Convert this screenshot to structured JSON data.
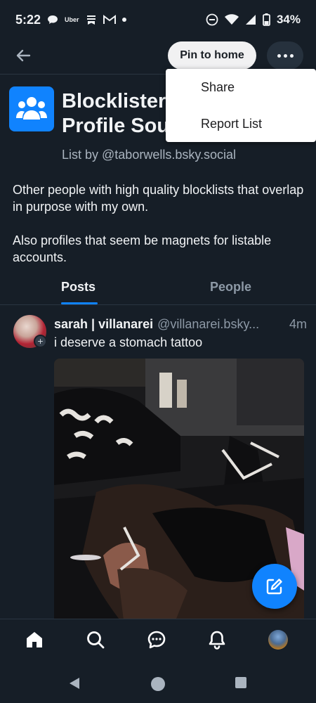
{
  "statusbar": {
    "time": "5:22",
    "uber": "Uber",
    "battery": "34%"
  },
  "topbar": {
    "pin_label": "Pin to home"
  },
  "menu": {
    "items": [
      "Share",
      "Report List"
    ]
  },
  "list": {
    "title_line1": "Blocklister",
    "title_line2": "Profile Sou",
    "by": "List by @taborwells.bsky.social",
    "desc1": "Other people with high quality blocklists that overlap in purpose with my own.",
    "desc2": "Also profiles that seem be magnets for listable accounts."
  },
  "tabs": [
    "Posts",
    "People"
  ],
  "post": {
    "name": "sarah | villanarei",
    "handle": "@villanarei.bsky...",
    "time": "4m",
    "text": "i deserve a stomach tattoo",
    "follow_symbol": "+"
  },
  "colors": {
    "background": "#161e27",
    "accent": "#1083fe",
    "menu_bg": "#ffffff",
    "divider": "#2a3541"
  },
  "icons": {
    "back": "arrow-left-icon",
    "more": "ellipsis-icon",
    "list": "people-group-icon",
    "fab": "compose-icon",
    "nav": [
      "home-icon",
      "search-icon",
      "chat-icon",
      "bell-icon",
      "profile-avatar"
    ],
    "system": [
      "back-triangle-icon",
      "home-circle-icon",
      "recents-square-icon"
    ]
  }
}
